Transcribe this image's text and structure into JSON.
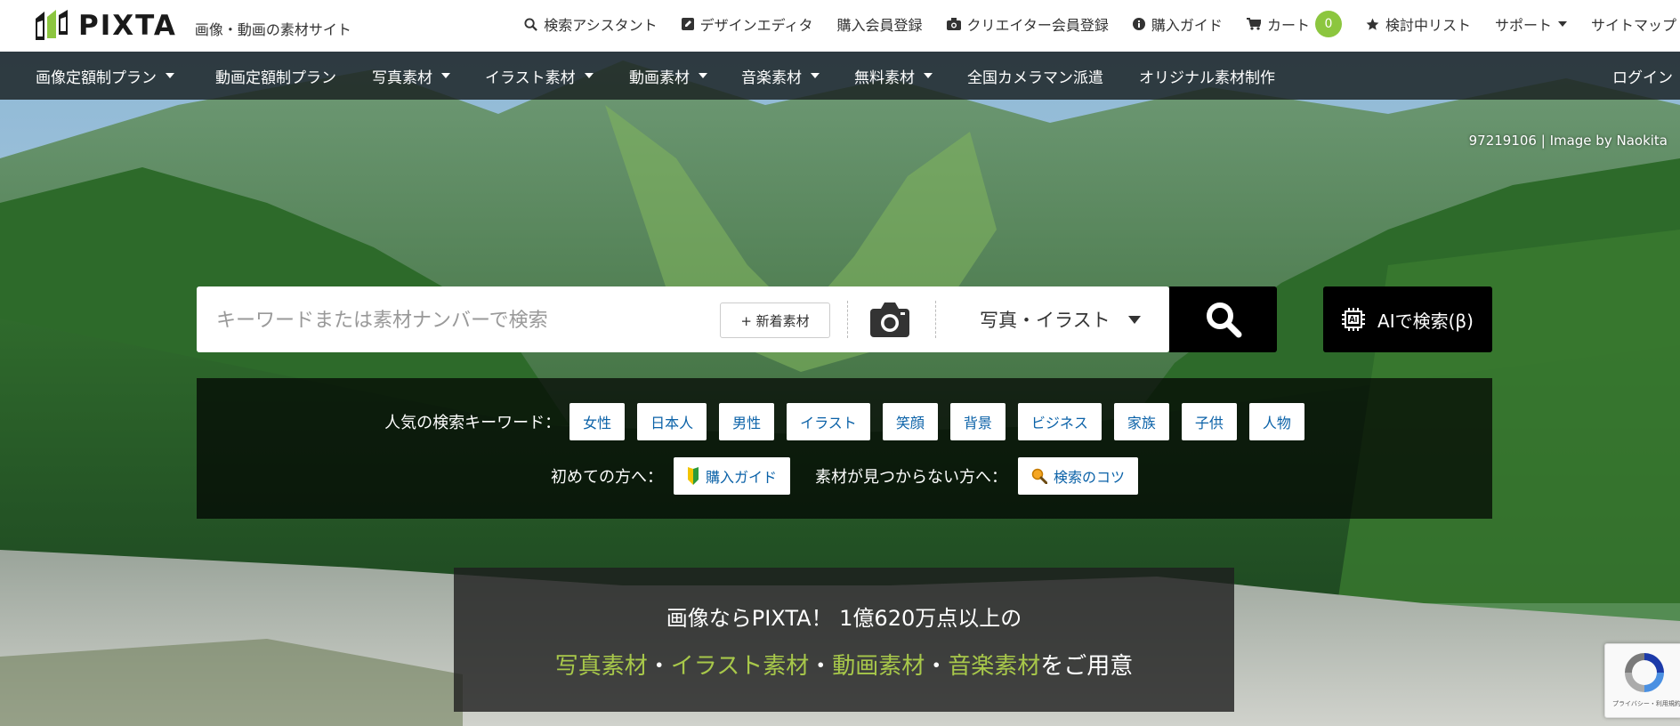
{
  "brand": {
    "name": "PIXTA",
    "tagline": "画像・動画の素材サイト"
  },
  "utility_nav": [
    {
      "label": "検索アシスタント",
      "icon": "search-icon"
    },
    {
      "label": "デザインエディタ",
      "icon": "edit-icon"
    },
    {
      "label": "購入会員登録",
      "icon": ""
    },
    {
      "label": "クリエイター会員登録",
      "icon": "camera-icon"
    },
    {
      "label": "購入ガイド",
      "icon": "info-icon"
    },
    {
      "label": "カート",
      "icon": "cart-icon",
      "badge": "0"
    },
    {
      "label": "検討中リスト",
      "icon": "star-icon"
    },
    {
      "label": "サポート",
      "icon": "chevron-down-icon"
    },
    {
      "label": "サイトマップ",
      "icon": ""
    }
  ],
  "main_nav": [
    {
      "label": "画像定額制プラン",
      "dropdown": true
    },
    {
      "label": "動画定額制プラン",
      "dropdown": false
    },
    {
      "label": "写真素材",
      "dropdown": true
    },
    {
      "label": "イラスト素材",
      "dropdown": true
    },
    {
      "label": "動画素材",
      "dropdown": true
    },
    {
      "label": "音楽素材",
      "dropdown": true
    },
    {
      "label": "無料素材",
      "dropdown": true
    },
    {
      "label": "全国カメラマン派遣",
      "dropdown": false
    },
    {
      "label": "オリジナル素材制作",
      "dropdown": false
    },
    {
      "label": "ログイン",
      "dropdown": false
    }
  ],
  "hero": {
    "credit": "97219106 | Image by Naokita"
  },
  "search": {
    "placeholder": "キーワードまたは素材ナンバーで検索",
    "new_label": "+ 新着素材",
    "category": "写真・イラスト",
    "ai_label": "AIで検索(β)"
  },
  "keywords": {
    "label": "人気の検索キーワード：",
    "tags": [
      "女性",
      "日本人",
      "男性",
      "イラスト",
      "笑顔",
      "背景",
      "ビジネス",
      "家族",
      "子供",
      "人物"
    ],
    "first_label": "初めての方へ：",
    "first_link": "購入ガイド",
    "notfound_label": "素材が見つからない方へ：",
    "notfound_link": "検索のコツ"
  },
  "promo": {
    "line1": "画像ならPIXTA！ 1億620万点以上の",
    "items": [
      "写真素材",
      "イラスト素材",
      "動画素材",
      "音楽素材"
    ],
    "sep": "・",
    "suffix": "をご用意"
  },
  "recaptcha": {
    "text": "プライバシー・利用規約"
  },
  "colors": {
    "accent": "#8cc63f",
    "link": "#0b62a8",
    "promo_highlight": "#a8c84a"
  }
}
